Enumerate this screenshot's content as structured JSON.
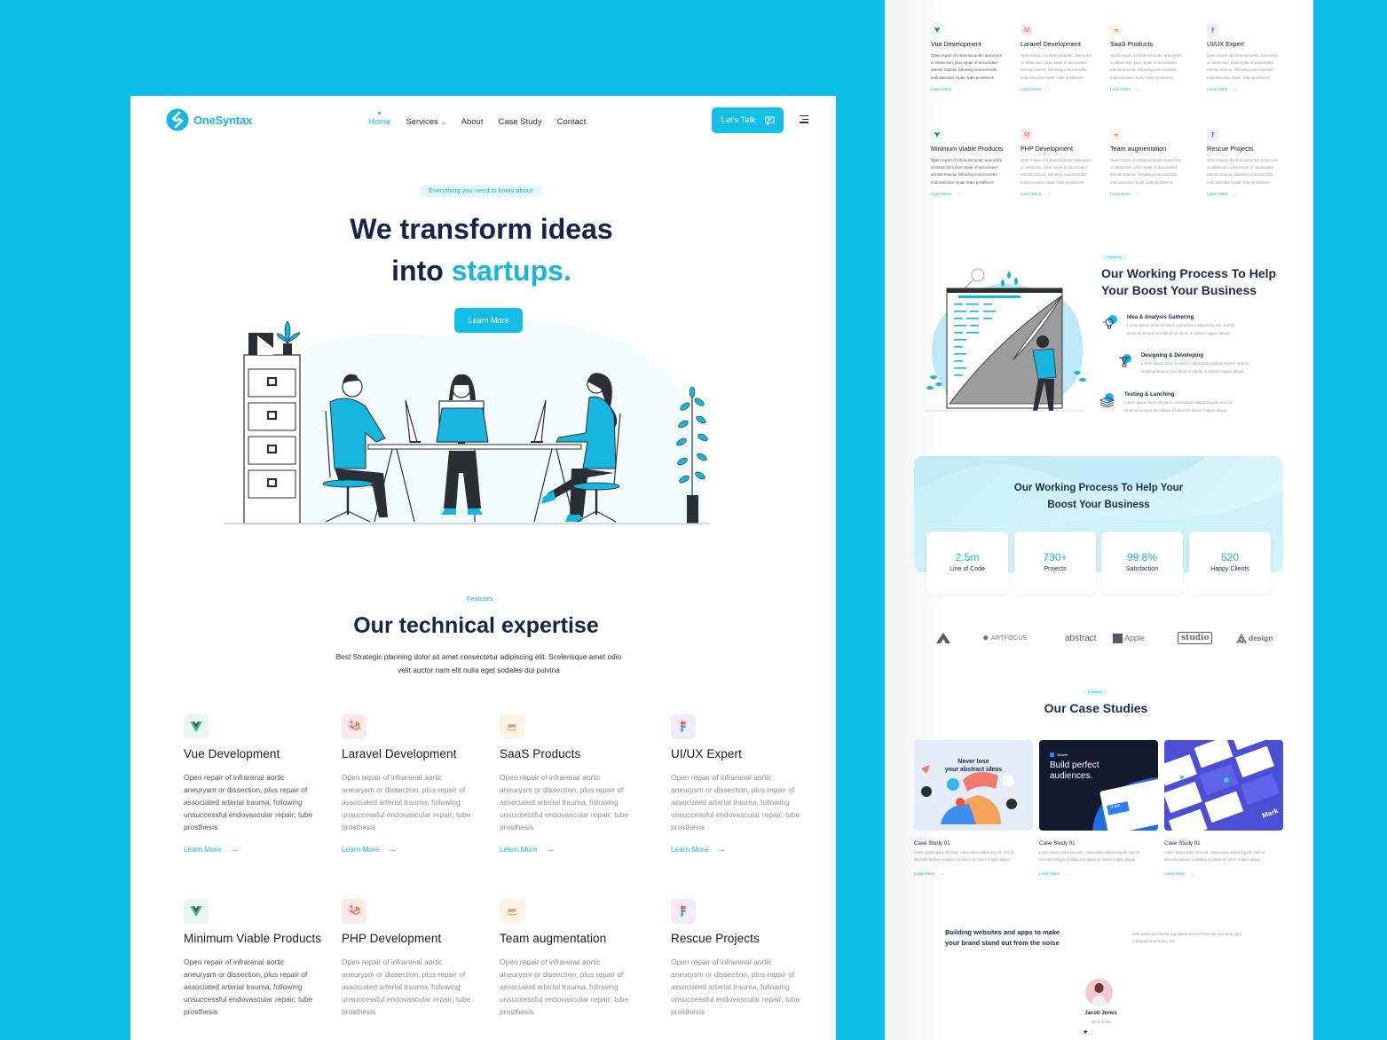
{
  "brand": {
    "name": "OneSyntax",
    "accent": "#17b6df",
    "navy": "#16234a",
    "page_bg": "#0cbde6"
  },
  "nav": {
    "items": [
      {
        "label": "Home",
        "active": true
      },
      {
        "label": "Services",
        "has_dropdown": true
      },
      {
        "label": "About"
      },
      {
        "label": "Case Study"
      },
      {
        "label": "Contact"
      }
    ],
    "cta_label": "Let's Talk",
    "cta_icon": "chat-icon",
    "menu_icon": "hamburger-icon"
  },
  "hero": {
    "pill": "Everything you need to know about",
    "title_line1": "We transform ideas",
    "title_line2_prefix": "into ",
    "title_line2_accent": "startups.",
    "button_label": "Learn More",
    "illustration": "office-team-illustration"
  },
  "features": {
    "label": "Features",
    "title": "Our technical expertise",
    "subtitle_line1": "Best Strategic planning dolor sit amet consectetur adipiscing elit. Scelerisque amet odio",
    "subtitle_line2": "velit auctor nam elit nulla eget sodales dui pulvina",
    "description": "Open repair of infrarenal aortic aneurysm or dissection, plus repair of associated arterial trauma, following unsuccessful endovascular repair; tube prosthesis",
    "link_label": "Learn More",
    "cards": [
      {
        "title": "Vue Development",
        "icon": "vue-icon"
      },
      {
        "title": "Laravel Development",
        "icon": "laravel-icon"
      },
      {
        "title": "SaaS Products",
        "icon": "aws-icon"
      },
      {
        "title": "UI/UX Expert",
        "icon": "figma-icon"
      },
      {
        "title": "Minimum Viable Products",
        "icon": "vue-icon"
      },
      {
        "title": "PHP Development",
        "icon": "laravel-icon"
      },
      {
        "title": "Team augmentation",
        "icon": "aws-icon"
      },
      {
        "title": "Rescue Projects",
        "icon": "figma-icon"
      }
    ],
    "aws_text": "aws"
  },
  "process": {
    "pill": "Features",
    "title_line1": "Our Working Process To Help",
    "title_line2": "Your Boost Your Business",
    "step_desc_line1": "Lorem ipsum dolor sit amet, consectetur adipiscing elit, sed do",
    "step_desc_line2": "eiusmod tempor incididunt ut labore et dolore magna aliqua.",
    "steps": [
      {
        "title": "Idea & Analysis Gathering",
        "icon": "lightbulb-icon"
      },
      {
        "title": "Designing & Developing",
        "icon": "design-pen-icon"
      },
      {
        "title": "Testing & Lunching",
        "icon": "money-stack-icon"
      }
    ]
  },
  "stats": {
    "title_line1": "Our Working Process To Help Your",
    "title_line2": "Boost Your Business",
    "items": [
      {
        "value": "2.5m",
        "label": "Line of Code"
      },
      {
        "value": "730+",
        "label": "Projects"
      },
      {
        "value": "99.8%",
        "label": "Satisfaction"
      },
      {
        "value": "520",
        "label": "Happy Clients"
      }
    ]
  },
  "brands": [
    "",
    "ARTFOCUS",
    "abstract",
    "Apple",
    "studio",
    "design"
  ],
  "case_studies": {
    "pill": "Features",
    "title": "Our Case Studies",
    "desc_line1": "Lorem ipsum dolor sit amet, consectetur adipiscing elit, sed do",
    "desc_line2": "eiusmod tempor incididunt ut labore et dolore magna aliqua.",
    "link_label": "Learn More",
    "items": [
      {
        "title": "Case Study 01",
        "thumb_line1": "Never lose",
        "thumb_line2": "your abstract ideas"
      },
      {
        "title": "Case Study 01",
        "thumb_brand": "Clearbit",
        "thumb_line1": "Build perfect",
        "thumb_line2": "audiences.",
        "thumb_metric": "12,800"
      },
      {
        "title": "Case Study 01",
        "thumb_word": "Mark"
      }
    ]
  },
  "testimonials": {
    "heading_line1": "Building websites and apps to make",
    "heading_line2": "your brand stand out from the noise",
    "intro_line1": "See what our clients say about us and how we can help your",
    "intro_line2": "company and team, too.",
    "name": "Jacob Jones",
    "role": "Jacob Jones",
    "star": "★"
  }
}
